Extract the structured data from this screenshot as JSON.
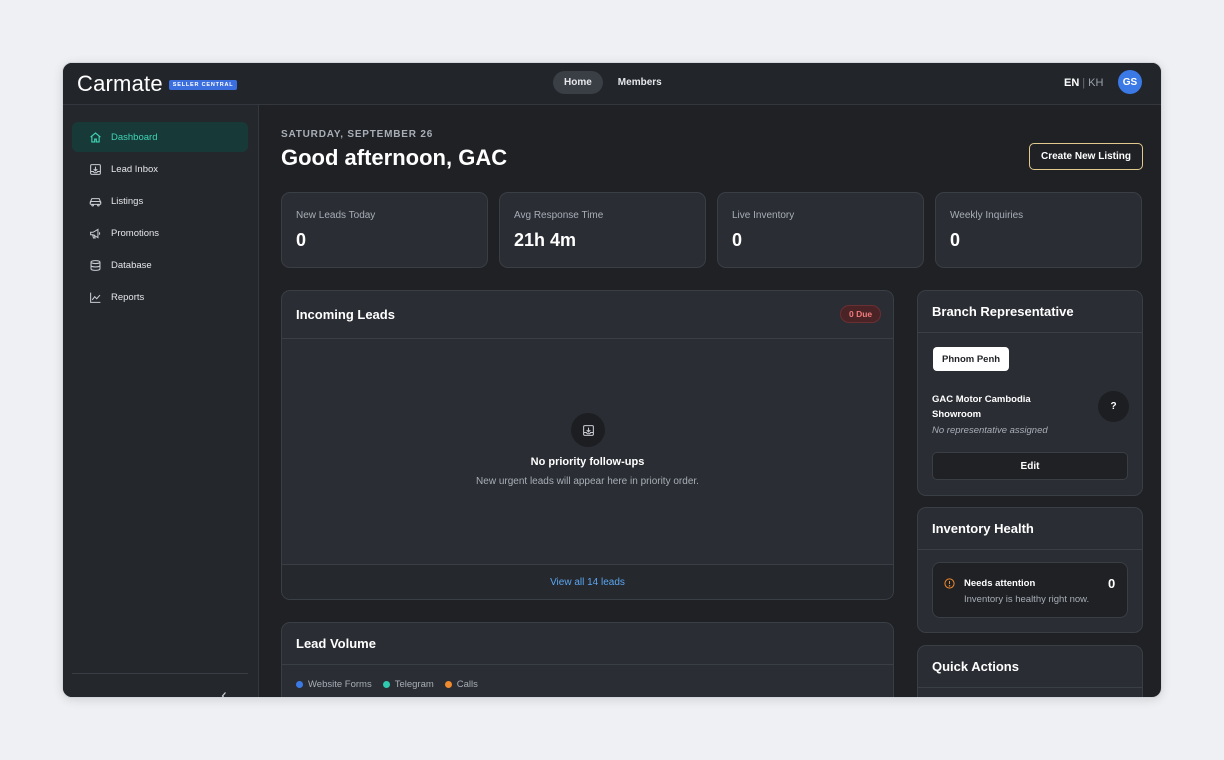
{
  "brand": {
    "name": "Carmate",
    "badge": "SELLER CENTRAL"
  },
  "topnav": {
    "tabs": [
      {
        "label": "Home"
      },
      {
        "label": "Members"
      }
    ],
    "lang_en": "EN",
    "lang_sep": "|",
    "lang_kh": "KH",
    "avatar_initials": "GS"
  },
  "sidebar": {
    "items": [
      {
        "label": "Dashboard",
        "icon": "home-icon"
      },
      {
        "label": "Lead Inbox",
        "icon": "inbox-download-icon"
      },
      {
        "label": "Listings",
        "icon": "car-icon"
      },
      {
        "label": "Promotions",
        "icon": "megaphone-icon"
      },
      {
        "label": "Database",
        "icon": "database-icon"
      },
      {
        "label": "Reports",
        "icon": "chart-line-icon"
      }
    ],
    "collapse_icon": "chevron-left-icon"
  },
  "header": {
    "date": "SATURDAY, SEPTEMBER 26",
    "greeting": "Good afternoon, GAC",
    "create_button": "Create New Listing"
  },
  "stats": [
    {
      "label": "New Leads Today",
      "value": "0"
    },
    {
      "label": "Avg Response Time",
      "value": "21h 4m"
    },
    {
      "label": "Live Inventory",
      "value": "0"
    },
    {
      "label": "Weekly Inquiries",
      "value": "0"
    }
  ],
  "incoming_leads": {
    "title": "Incoming Leads",
    "badge": "0 Due",
    "empty_title": "No priority follow-ups",
    "empty_subtitle": "New urgent leads will appear here in priority order.",
    "view_all": "View all 14 leads"
  },
  "lead_volume": {
    "title": "Lead Volume",
    "legend": [
      {
        "label": "Website Forms",
        "color": "#3b7ae6"
      },
      {
        "label": "Telegram",
        "color": "#2fc9b0"
      },
      {
        "label": "Calls",
        "color": "#f08a2e"
      }
    ]
  },
  "branch": {
    "title": "Branch Representative",
    "location": "Phnom Penh",
    "showroom": "GAC Motor Cambodia Showroom",
    "no_rep": "No representative assigned",
    "avatar_placeholder": "?",
    "edit_button": "Edit"
  },
  "inventory_health": {
    "title": "Inventory Health",
    "attention_title": "Needs attention",
    "attention_subtitle": "Inventory is healthy right now.",
    "attention_count": "0"
  },
  "quick_actions": {
    "title": "Quick Actions"
  },
  "colors": {
    "accent_teal": "#3fd4b5",
    "link_blue": "#5ba6f0",
    "warning_orange": "#f08a2e",
    "danger_red": "#f07b7b"
  }
}
